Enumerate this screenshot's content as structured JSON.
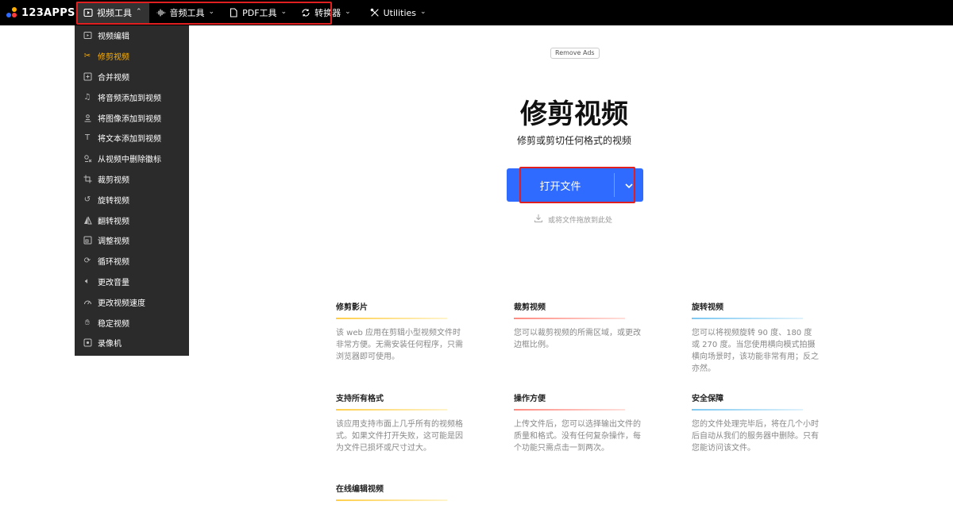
{
  "logo": {
    "text": "123APPS"
  },
  "nav": {
    "items": [
      {
        "label": "视频工具",
        "icon": "video-icon"
      },
      {
        "label": "音频工具",
        "icon": "audio-wave-icon"
      },
      {
        "label": "PDF工具",
        "icon": "document-icon"
      },
      {
        "label": "转换器",
        "icon": "convert-icon"
      },
      {
        "label": "Utilities",
        "icon": "tools-icon"
      }
    ]
  },
  "dropdown": {
    "items": [
      {
        "label": "视频编辑",
        "icon": "video-edit-icon"
      },
      {
        "label": "修剪视频",
        "icon": "scissors-icon"
      },
      {
        "label": "合并视频",
        "icon": "merge-icon"
      },
      {
        "label": "将音频添加到视频",
        "icon": "music-note-icon"
      },
      {
        "label": "将图像添加到视频",
        "icon": "image-icon"
      },
      {
        "label": "将文本添加到视频",
        "icon": "text-icon"
      },
      {
        "label": "从视频中删除徽标",
        "icon": "remove-logo-icon"
      },
      {
        "label": "裁剪视频",
        "icon": "crop-icon"
      },
      {
        "label": "旋转视频",
        "icon": "rotate-icon"
      },
      {
        "label": "翻转视频",
        "icon": "flip-icon"
      },
      {
        "label": "调整视频",
        "icon": "resize-icon"
      },
      {
        "label": "循环视频",
        "icon": "loop-icon"
      },
      {
        "label": "更改音量",
        "icon": "volume-icon"
      },
      {
        "label": "更改视频速度",
        "icon": "speed-icon"
      },
      {
        "label": "稳定视频",
        "icon": "stabilize-icon"
      },
      {
        "label": "录像机",
        "icon": "recorder-icon"
      }
    ]
  },
  "main": {
    "remove_ads": "Remove Ads",
    "title": "修剪视频",
    "subtitle": "修剪或剪切任何格式的视频",
    "open_button": "打开文件",
    "drop_hint": "或将文件拖放到此处"
  },
  "features": [
    {
      "title": "修剪影片",
      "text": "该 web 应用在剪辑小型视频文件时非常方便。无需安装任何程序，只需浏览器即可使用。",
      "color": "#ffcf4d"
    },
    {
      "title": "裁剪视频",
      "text": "您可以裁剪视频的所需区域，或更改边框比例。",
      "color": "#ff8a80"
    },
    {
      "title": "旋转视频",
      "text": "您可以将视频旋转 90 度、180 度或 270 度。当您使用横向模式拍摄横向场景时，该功能非常有用；反之亦然。",
      "color": "#7ec8f2"
    },
    {
      "title": "支持所有格式",
      "text": "该应用支持市面上几乎所有的视频格式。如果文件打开失败，这可能是因为文件已损坏或尺寸过大。",
      "color": "#ffcf4d"
    },
    {
      "title": "操作方便",
      "text": "上传文件后，您可以选择输出文件的质量和格式。没有任何复杂操作，每个功能只需点击一到两次。",
      "color": "#ff8a80"
    },
    {
      "title": "安全保障",
      "text": "您的文件处理完毕后，将在几个小时后自动从我们的服务器中删除。只有您能访问该文件。",
      "color": "#7ec8f2"
    },
    {
      "title": "在线编辑视频",
      "text": "",
      "color": "#ffcf4d"
    }
  ],
  "colors": {
    "accent": "#2f6bff",
    "active_menu": "#ffb000",
    "highlight_box": "#e02020"
  }
}
